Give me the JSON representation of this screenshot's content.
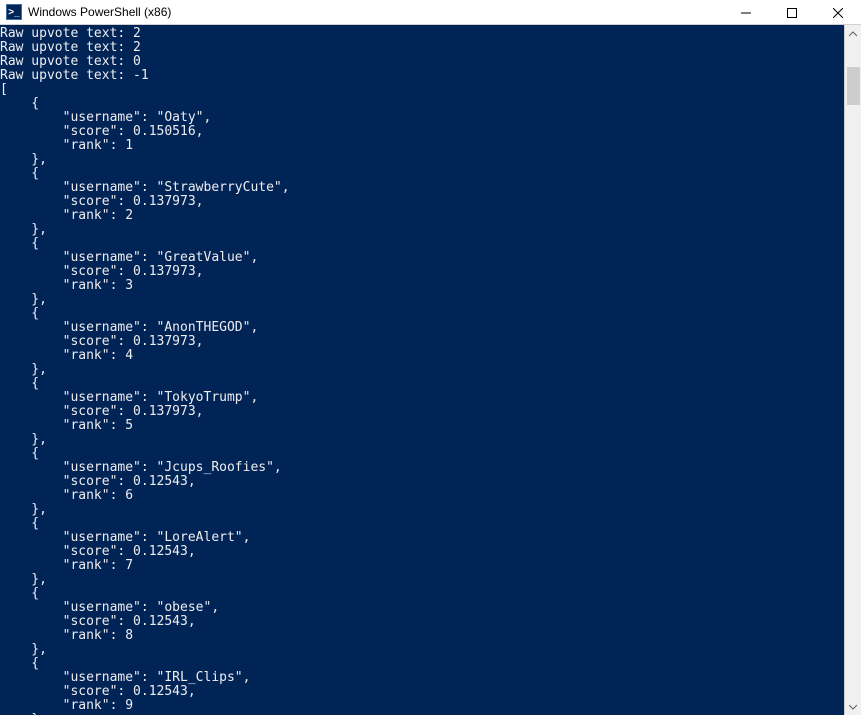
{
  "window": {
    "title": "Windows PowerShell (x86)",
    "icon_label": ">_"
  },
  "console": {
    "raw_lines": [
      {
        "prefix": "Raw upvote text: ",
        "value": "2"
      },
      {
        "prefix": "Raw upvote text: ",
        "value": "2"
      },
      {
        "prefix": "Raw upvote text: ",
        "value": "0"
      },
      {
        "prefix": "Raw upvote text: ",
        "value": "-1"
      }
    ],
    "array_open": "[",
    "entries": [
      {
        "username": "Oaty",
        "score": "0.150516",
        "rank": "1"
      },
      {
        "username": "StrawberryCute",
        "score": "0.137973",
        "rank": "2"
      },
      {
        "username": "GreatValue",
        "score": "0.137973",
        "rank": "3"
      },
      {
        "username": "AnonTHEGOD",
        "score": "0.137973",
        "rank": "4"
      },
      {
        "username": "TokyoTrump",
        "score": "0.137973",
        "rank": "5"
      },
      {
        "username": "Jcups_Roofies",
        "score": "0.12543",
        "rank": "6"
      },
      {
        "username": "LoreAlert",
        "score": "0.12543",
        "rank": "7"
      },
      {
        "username": "obese",
        "score": "0.12543",
        "rank": "8"
      },
      {
        "username": "IRL_Clips",
        "score": "0.12543",
        "rank": "9"
      }
    ],
    "json_labels": {
      "username": "\"username\": ",
      "score": "\"score\": ",
      "rank": "\"rank\": ",
      "open_brace": "    {",
      "close_brace": "    },",
      "indent": "        "
    }
  }
}
